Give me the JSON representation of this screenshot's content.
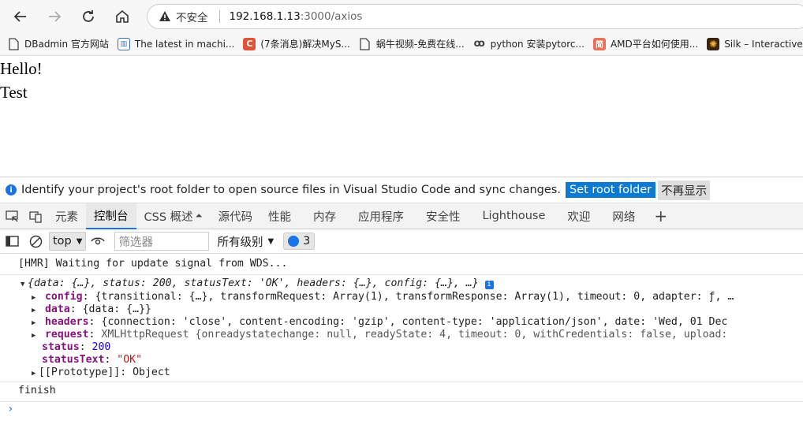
{
  "browser": {
    "insecure_label": "不安全",
    "host": "192.168.1.13",
    "path": ":3000/axios"
  },
  "bookmarks": [
    {
      "label": "DBadmin 官方网站",
      "icon": "page-icon"
    },
    {
      "label": "The latest in machi...",
      "icon": "pwc-icon"
    },
    {
      "label": "(7条消息)解决MyS...",
      "icon": "csdn-icon"
    },
    {
      "label": "蜗牛视频-免费在线...",
      "icon": "page-icon"
    },
    {
      "label": "python 安装pytorc...",
      "icon": "python-icon"
    },
    {
      "label": "AMD平台如何使用...",
      "icon": "jianshu-icon"
    },
    {
      "label": "Silk – Interactive Ge",
      "icon": "silk-icon"
    }
  ],
  "page": {
    "line1": "Hello!",
    "line2": "Test"
  },
  "devtools": {
    "infobar_text": "Identify your project's root folder to open source files in Visual Studio Code and sync changes.",
    "set_root_label": "Set root folder",
    "dismiss_label": "不再显示",
    "tabs": [
      "元素",
      "控制台",
      "CSS 概述",
      "源代码",
      "性能",
      "内存",
      "应用程序",
      "安全性",
      "Lighthouse",
      "欢迎",
      "网络"
    ],
    "context": "top",
    "filter_placeholder": "筛选器",
    "levels_label": "所有级别",
    "message_count": "3",
    "accent_color": "#1a73e8"
  },
  "console": {
    "hmr": "[HMR] Waiting for update signal from WDS...",
    "summary": "{data: {…}, status: 200, statusText: 'OK', headers: {…}, config: {…}, …}",
    "config_key": "config",
    "config_val": "{transitional: {…}, transformRequest: Array(1), transformResponse: Array(1), timeout: 0, adapter: ƒ, …",
    "data_key": "data",
    "data_val": "{data: {…}}",
    "headers_key": "headers",
    "headers_val": "{connection: 'close', content-encoding: 'gzip', content-type: 'application/json', date: 'Wed, 01 Dec",
    "request_key": "request",
    "request_val": "XMLHttpRequest {onreadystatechange: null, readyState: 4, timeout: 0, withCredentials: false, upload:",
    "status_key": "status",
    "status_val": "200",
    "statusText_key": "statusText",
    "statusText_val": "\"OK\"",
    "proto_key": "[[Prototype]]",
    "proto_val": "Object",
    "finish": "finish"
  }
}
